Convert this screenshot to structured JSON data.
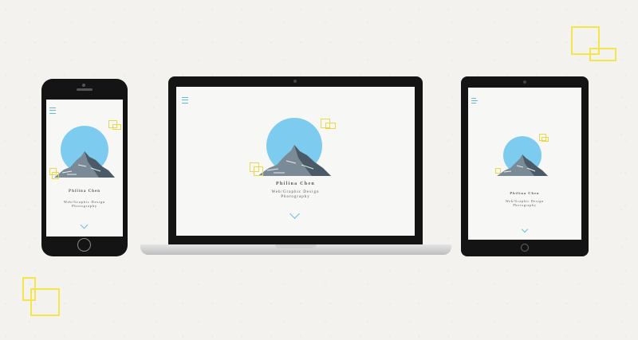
{
  "site": {
    "name": "Philina Chen",
    "tagline": "Web/Graphic Design",
    "subtitle": "Photography"
  },
  "colors": {
    "accent": "#7dccef",
    "decor": "#f4e54a",
    "device": "#141414",
    "background": "#f3f2ee"
  },
  "icons": {
    "menu": "hamburger-icon",
    "scroll": "chevron-down-icon",
    "illustration": "mountain-icon"
  }
}
